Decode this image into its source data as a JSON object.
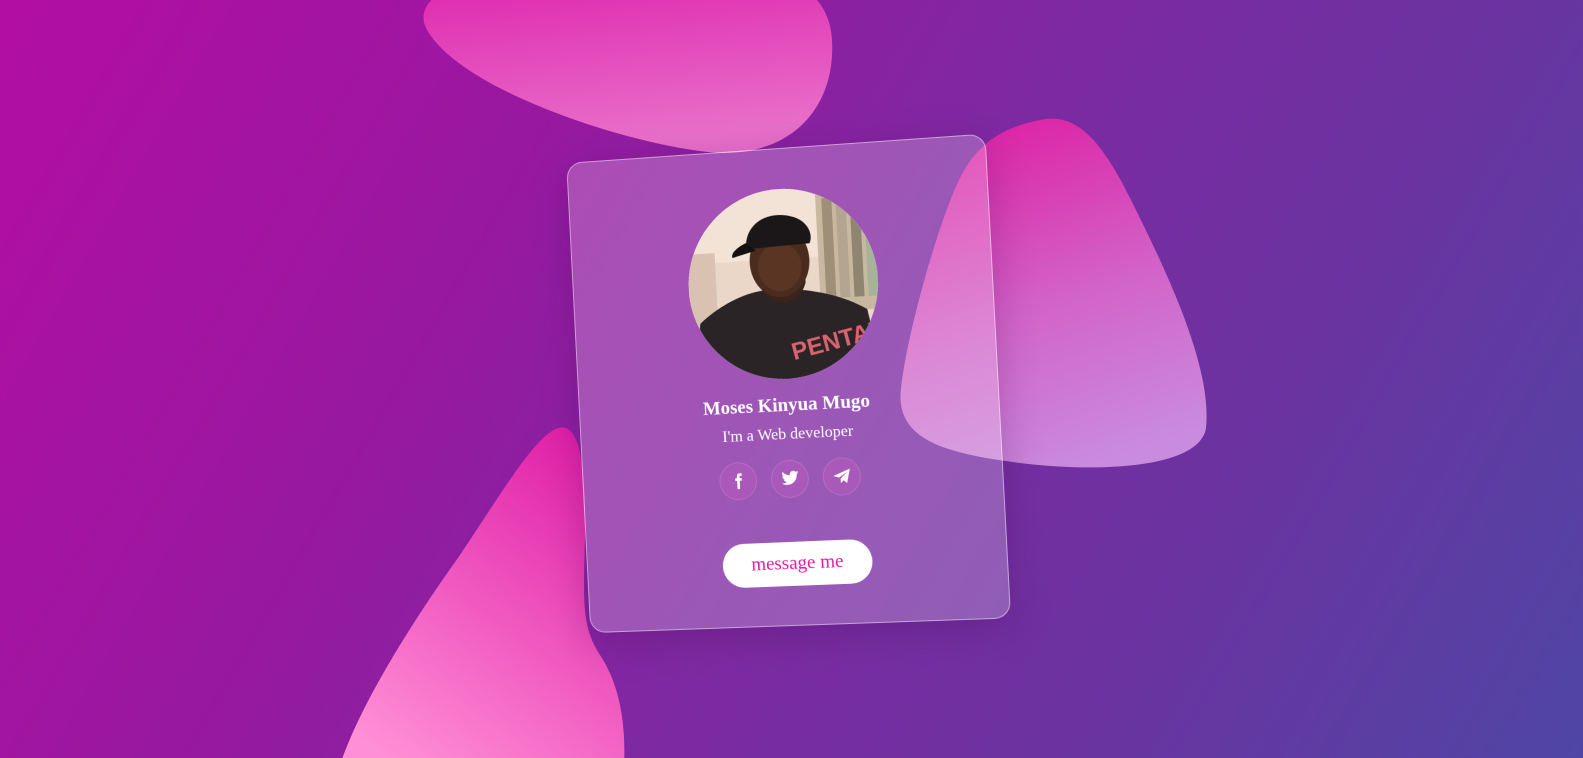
{
  "profile": {
    "name": "Moses Kinyua Mugo",
    "tagline": "I'm a Web developer",
    "photo_alt": "profile photo",
    "shirt_text": "PENTAX"
  },
  "socials": [
    {
      "icon": "facebook-icon"
    },
    {
      "icon": "twitter-icon"
    },
    {
      "icon": "telegram-icon"
    }
  ],
  "actions": {
    "message_label": "message me"
  },
  "colors": {
    "background_start": "#b30ea4",
    "background_end": "#4f46a4",
    "blob_pink": "#e01fa8",
    "blob_light": "#f58fd0",
    "button_text": "#e3169e",
    "button_bg": "#ffffff"
  }
}
